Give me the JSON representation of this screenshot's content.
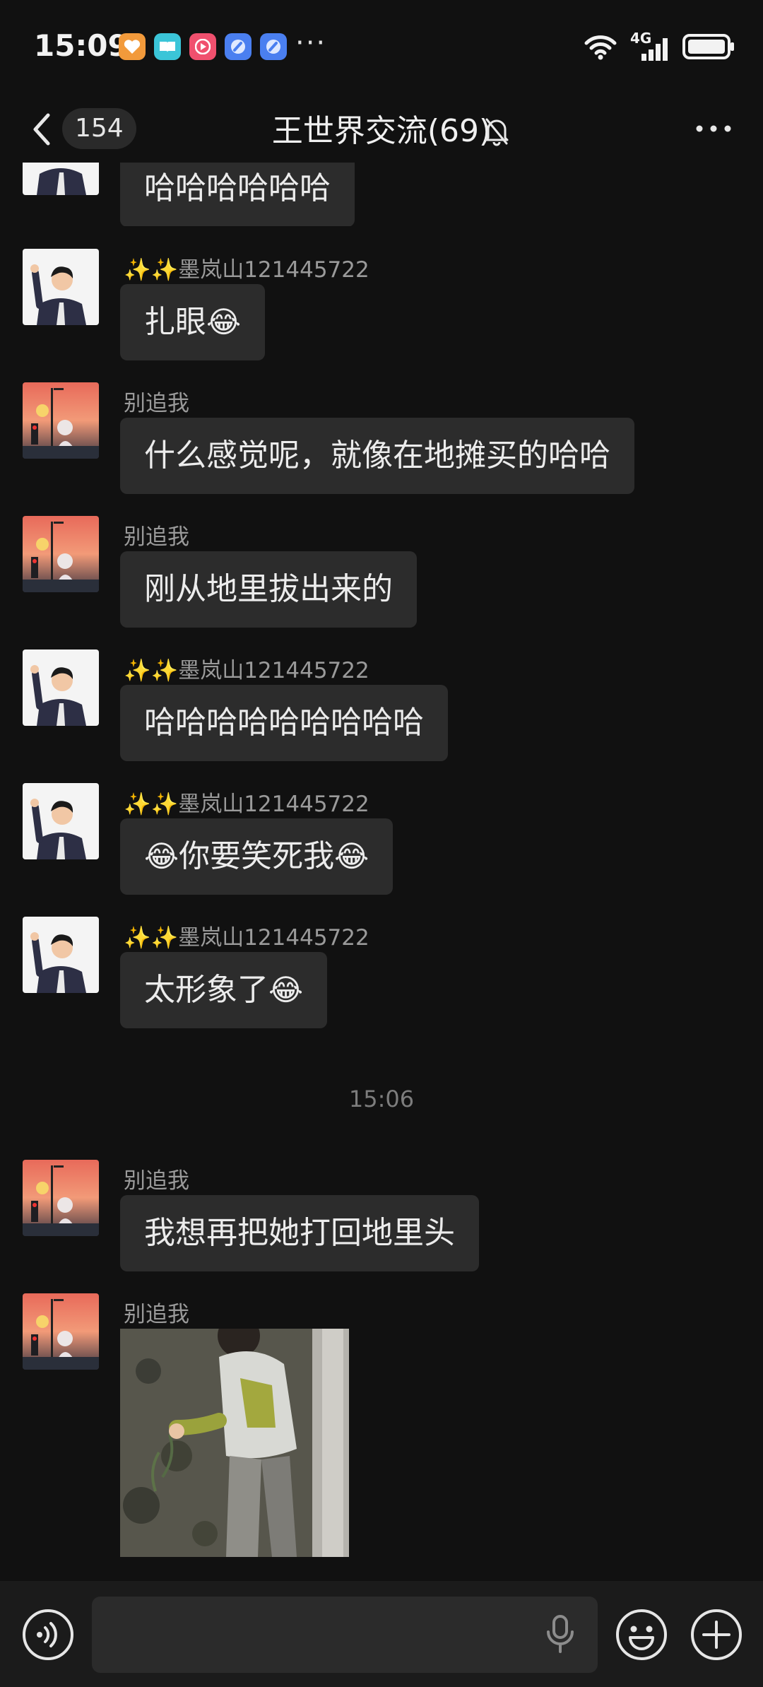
{
  "status_bar": {
    "time": "15:09",
    "more": "···",
    "network": "4G",
    "notification_icons": [
      "health-app-icon",
      "book-app-icon",
      "video-app-icon",
      "browser-app-icon",
      "browser-app-icon"
    ]
  },
  "nav": {
    "unread_count": "154",
    "title": "王世界交流(69)"
  },
  "messages": [
    {
      "sender": "",
      "text": "哈哈哈哈哈哈",
      "avatar": "avatar-boy-waving"
    },
    {
      "sender": "✨✨墨岚山121445722",
      "text": "扎眼",
      "emoji_after": "😂",
      "avatar": "avatar-boy-waving"
    },
    {
      "sender": "别追我",
      "text": "什么感觉呢，就像在地摊买的哈哈",
      "avatar": "avatar-sunset"
    },
    {
      "sender": "别追我",
      "text": "刚从地里拔出来的",
      "avatar": "avatar-sunset"
    },
    {
      "sender": "✨✨墨岚山121445722",
      "text": "哈哈哈哈哈哈哈哈哈",
      "avatar": "avatar-boy-waving"
    },
    {
      "sender": "✨✨墨岚山121445722",
      "text": "你要笑死我",
      "emoji_before": "😂",
      "emoji_after": "😂",
      "avatar": "avatar-boy-waving"
    },
    {
      "sender": "✨✨墨岚山121445722",
      "text": "太形象了",
      "emoji_after": "😂",
      "avatar": "avatar-boy-waving"
    },
    {
      "sender": "别追我",
      "text": "我想再把她打回地里头",
      "avatar": "avatar-sunset"
    },
    {
      "sender": "别追我",
      "image": "photo-child-in-field",
      "avatar": "avatar-sunset"
    }
  ],
  "timestamp": "15:06",
  "input": {
    "placeholder": ""
  },
  "colors": {
    "background": "#111111",
    "bubble": "#2c2c2c",
    "sender": "#9a9a9a",
    "input_bar": "#1b1b1b"
  }
}
